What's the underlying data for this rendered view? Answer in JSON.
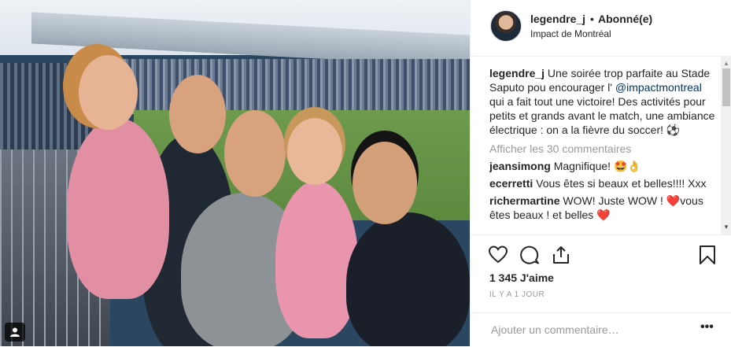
{
  "post": {
    "badge_icon": "user-tag-icon",
    "username": "legendre_j",
    "separator": "•",
    "follow_label": "Abonné(e)",
    "location": "Impact de Montréal",
    "caption": {
      "username": "legendre_j",
      "text_before": "Une soirée trop parfaite au Stade Saputo pou encourager l'",
      "mention": "@impactmontreal",
      "text_after": "qui a fait tout une victoire! Des activités pour petits et grands avant le match, une ambiance électrique : on a la fièvre du soccer! ⚽"
    },
    "view_all": "Afficher les 30 commentaires",
    "comments": [
      {
        "username": "jeansimong",
        "text": "Magnifique! 🤩👌"
      },
      {
        "username": "ecerretti",
        "text": "Vous êtes si beaux et belles!!!! Xxx"
      },
      {
        "username": "richermartine",
        "text": "WOW! Juste WOW ! ❤️vous êtes beaux ! et belles ❤️"
      }
    ],
    "likes": "1 345 J'aime",
    "time": "IL Y A 1 JOUR",
    "comment_placeholder": "Ajouter un commentaire…",
    "more_label": "•••",
    "scroll_up": "▲",
    "scroll_down": "▼"
  }
}
